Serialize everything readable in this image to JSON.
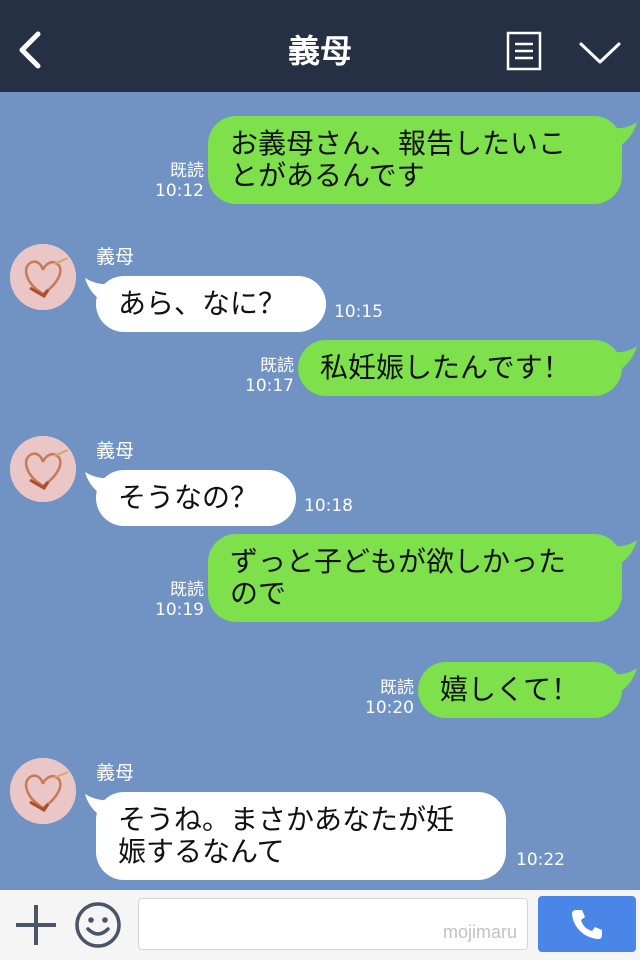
{
  "header": {
    "title": "義母"
  },
  "messages": [
    {
      "dir": "out",
      "text": "お義母さん、報告したいこ\nとがあるんです",
      "read": "既読",
      "time": "10:12"
    },
    {
      "dir": "in",
      "sender": "義母",
      "text": "あら、なに？",
      "time": "10:15"
    },
    {
      "dir": "out",
      "text": "私妊娠したんです！",
      "read": "既読",
      "time": "10:17"
    },
    {
      "dir": "in",
      "sender": "義母",
      "text": "そうなの？",
      "time": "10:18"
    },
    {
      "dir": "out",
      "text": "ずっと子どもが欲しかった\nので",
      "read": "既読",
      "time": "10:19"
    },
    {
      "dir": "out",
      "text": "嬉しくて！",
      "read": "既読",
      "time": "10:20"
    },
    {
      "dir": "in",
      "sender": "義母",
      "text": "そうね。まさかあなたが妊\n娠するなんて",
      "time": "10:22"
    }
  ],
  "footer": {
    "watermark": "mojimaru"
  },
  "colors": {
    "header": "#253044",
    "chat_background": "#7093c4",
    "outgoing_bubble": "#7ee04a",
    "incoming_bubble": "#ffffff",
    "call_button": "#4a86e8"
  },
  "icons": {
    "back": "back-arrow-icon",
    "menu": "menu-icon",
    "collapse": "chevron-down-icon",
    "plus": "plus-icon",
    "emoji": "emoji-icon",
    "call": "phone-icon"
  }
}
